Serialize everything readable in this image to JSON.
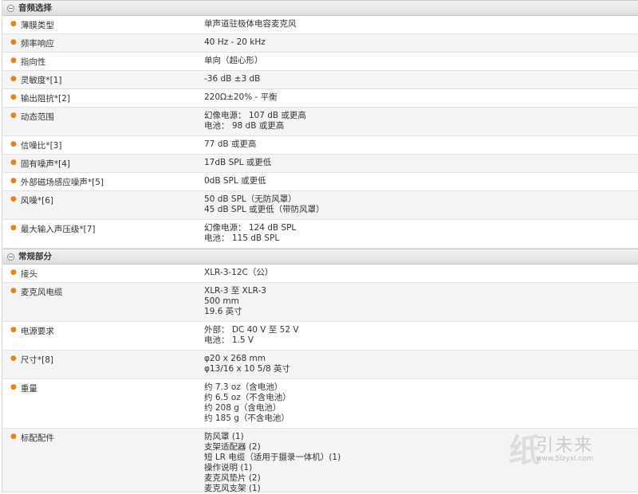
{
  "sections": [
    {
      "title": "音频选择",
      "rows": [
        {
          "key": "薄膜类型",
          "value": [
            "单声道驻极体电容麦克风"
          ]
        },
        {
          "key": "频率响应",
          "value": [
            "40 Hz - 20 kHz"
          ]
        },
        {
          "key": "指向性",
          "value": [
            "单向（超心形）"
          ]
        },
        {
          "key": "灵敏度*[1]",
          "value": [
            "-36 dB ±3 dB"
          ]
        },
        {
          "key": "输出阻抗*[2]",
          "value": [
            "220Ω±20% - 平衡"
          ]
        },
        {
          "key": "动态范围",
          "value": [
            "幻像电源： 107 dB 或更高",
            "电池： 98 dB 或更高"
          ]
        },
        {
          "key": "信噪比*[3]",
          "value": [
            "77 dB 或更高"
          ]
        },
        {
          "key": "固有噪声*[4]",
          "value": [
            "17dB SPL 或更低"
          ]
        },
        {
          "key": "外部磁场感应噪声*[5]",
          "value": [
            "0dB SPL 或更低"
          ]
        },
        {
          "key": "风噪*[6]",
          "value": [
            "50 dB SPL（无防风罩）",
            "45 dB SPL 或更低（带防风罩）"
          ]
        },
        {
          "key": "最大输入声压级*[7]",
          "value": [
            "幻像电源： 124 dB SPL",
            "电池： 115 dB SPL"
          ]
        }
      ]
    },
    {
      "title": "常规部分",
      "rows": [
        {
          "key": "接头",
          "value": [
            "XLR-3-12C（公）"
          ]
        },
        {
          "key": "麦克风电缆",
          "value": [
            "XLR-3 至 XLR-3",
            "500 mm",
            "19.6 英寸"
          ]
        },
        {
          "key": "电源要求",
          "value": [
            "外部： DC 40 V 至 52 V",
            "电池： 1.5 V"
          ]
        },
        {
          "key": "尺寸*[8]",
          "value": [
            "φ20 x 268 mm",
            "φ13/16 x 10 5/8 英寸"
          ]
        },
        {
          "key": "重量",
          "value": [
            "约 7.3 oz（含电池）",
            "约 6.5 oz（不含电池）",
            "约 208 g（含电池）",
            "约 185 g（不含电池）"
          ]
        },
        {
          "key": "标配配件",
          "value": [
            "防风罩 (1)",
            "支架适配器 (2)",
            "短 LR 电缆（适用于摄录一体机）(1)",
            "操作说明 (1)",
            "麦克风垫片 (2)",
            "麦克风支架 (1)"
          ]
        }
      ]
    }
  ],
  "watermark": {
    "logo": "纸",
    "text": "引未来",
    "url": "www.5lzyxl.com"
  },
  "colors": {
    "bullet": "#e0851a",
    "header_bg": "#e6e6e6",
    "alt_row": "#f4f4f4"
  }
}
